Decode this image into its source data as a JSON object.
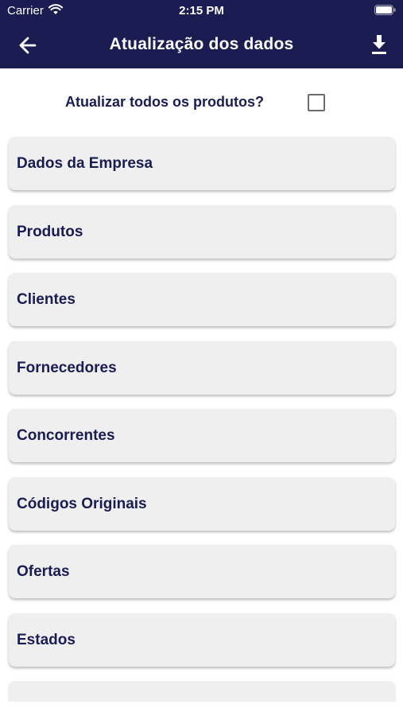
{
  "status_bar": {
    "carrier": "Carrier",
    "time": "2:15 PM",
    "wifi_icon": "wifi-icon",
    "battery_icon": "battery-icon"
  },
  "header": {
    "title": "Atualização dos dados",
    "back_icon": "arrow-left-icon",
    "download_icon": "download-icon",
    "background_color": "#1a1c52"
  },
  "update_all": {
    "label": "Atualizar todos os produtos?",
    "checked": false
  },
  "items": [
    {
      "label": "Dados da Empresa"
    },
    {
      "label": "Produtos"
    },
    {
      "label": "Clientes"
    },
    {
      "label": "Fornecedores"
    },
    {
      "label": "Concorrentes"
    },
    {
      "label": "Códigos Originais"
    },
    {
      "label": "Ofertas"
    },
    {
      "label": "Estados"
    }
  ],
  "colors": {
    "text_primary": "#1a1c52",
    "card_background": "#efefef"
  }
}
